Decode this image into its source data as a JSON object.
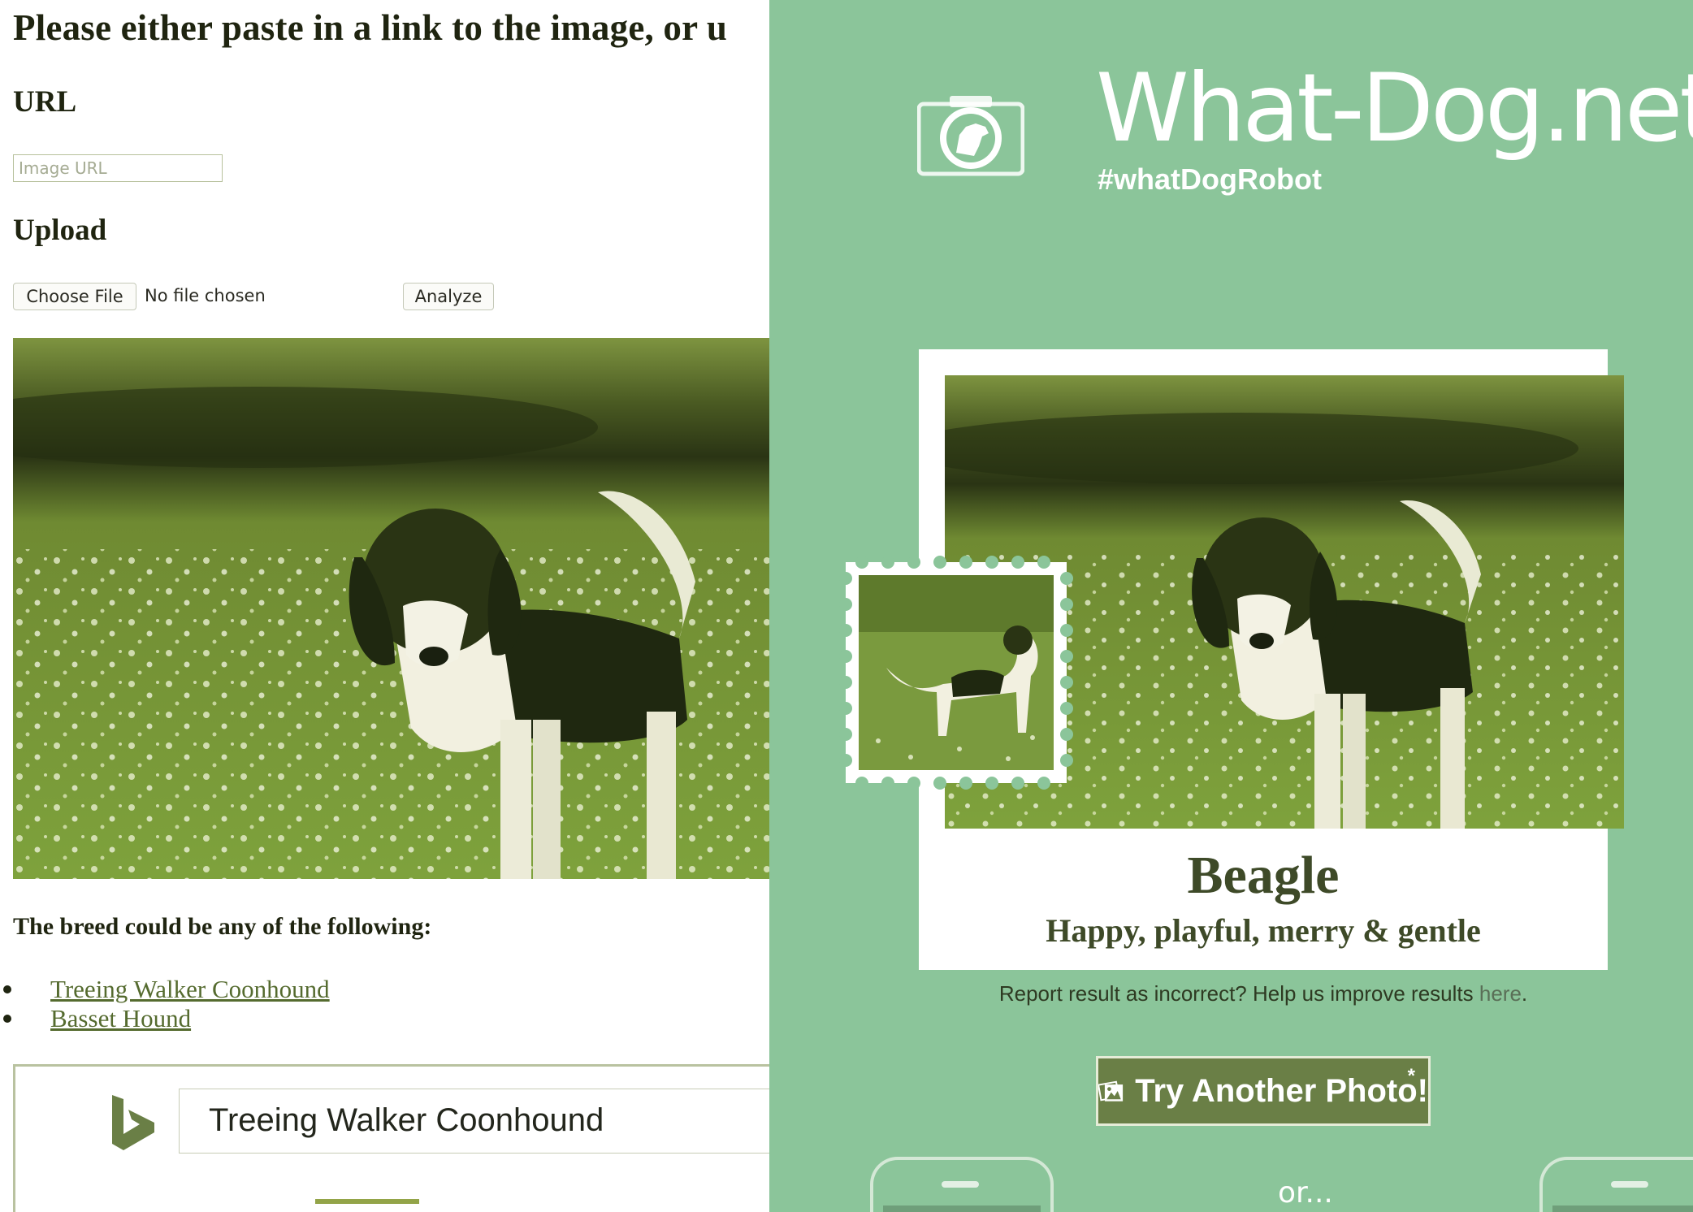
{
  "left": {
    "heading": "Please either paste in a link to the image, or u",
    "url_heading": "URL",
    "url_input": {
      "placeholder": "Image URL",
      "value": ""
    },
    "upload_heading": "Upload",
    "choose_file_label": "Choose File",
    "no_file_text": "No file chosen",
    "analyze_label": "Analyze",
    "breed_heading": "The breed could be any of the following:",
    "breeds": [
      "Treeing Walker Coonhound",
      "Basset Hound"
    ],
    "bing_search_value": "Treeing Walker Coonhound"
  },
  "right": {
    "site_title": "What-Dog.net",
    "hashtag": "#whatDogRobot",
    "result": {
      "breed": "Beagle",
      "tagline": "Happy, playful, merry & gentle"
    },
    "report_text": "Report result as incorrect? Help us improve results ",
    "report_link": "here",
    "report_suffix": ".",
    "try_button_label": "Try Another Photo!",
    "try_button_asterisk": "*",
    "or_text": "or..."
  },
  "colors": {
    "right_background": "#8bc59a",
    "link": "#556b2f",
    "dark_text": "#3e4a28",
    "button_bg": "#6a7f46"
  },
  "icons": [
    "bing-logo-icon",
    "camera-logo-icon",
    "photos-icon"
  ]
}
